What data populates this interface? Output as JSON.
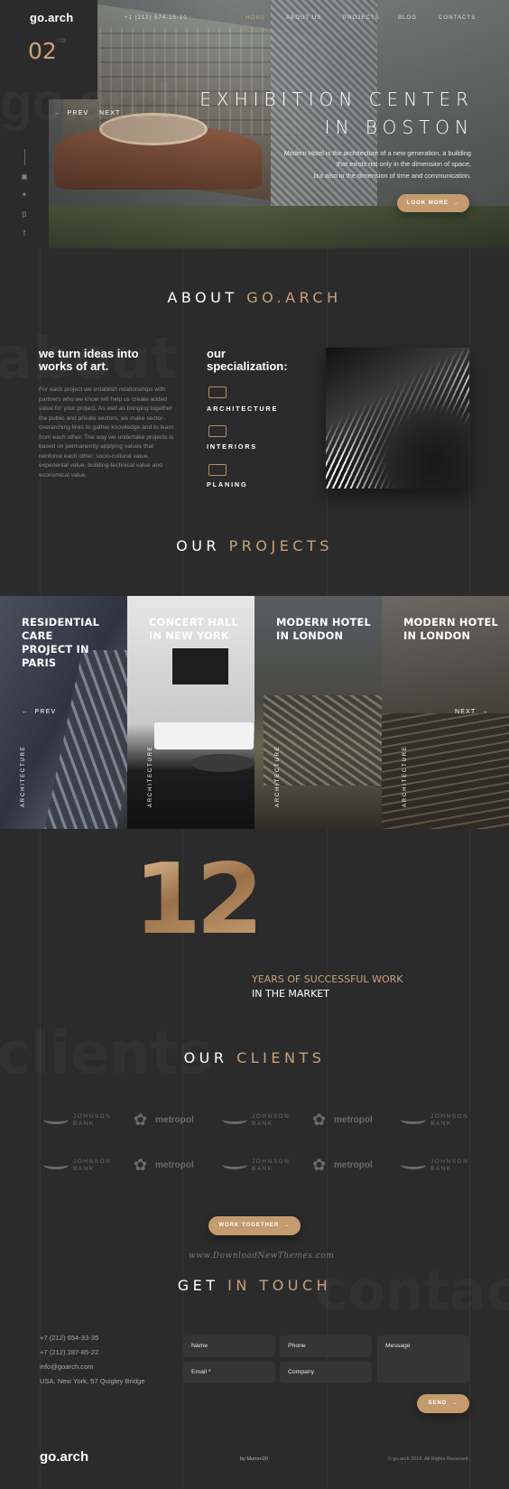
{
  "header": {
    "logo": "go.arch",
    "phone": "+1 (212) 674-25-10",
    "nav": [
      "HOME",
      "ABOUT US",
      "PROJECTS",
      "BLOG",
      "CONTACTS"
    ],
    "active_nav_color": "#c9a27a"
  },
  "hero": {
    "slide_current": "02",
    "slide_total": "/ 03",
    "ghost_text": "go.arch",
    "prev": "PREV",
    "next": "NEXT",
    "title_line1": "EXHIBITION CENTER",
    "title_line2": "IN BOSTON",
    "text_line1": "Modern Hotel is the architecture of a new generation, a building",
    "text_line2": "that exists not only in the dimension of space,",
    "text_line3": "but also in the dimension of time and communication.",
    "button": "LOOK MORE",
    "social_icons": [
      "instagram-icon",
      "twitter-icon",
      "behance-icon",
      "facebook-icon"
    ]
  },
  "about": {
    "title_a": "ABOUT",
    "title_b": "GO.ARCH",
    "ghost": "about",
    "head1": "we turn ideas into",
    "head2": "works of art.",
    "text": "For each project we establish relationships with partners who we know will help us create added value for your project. As well as bringing together the public and private sectors, we make sector-overarching links to gather knowledge and to learn from each other. The way we undertake projects is based on permanently applying values that reinforce each other: socio-cultural value, experiental value, building-technical value and economical value.",
    "spec1": "our",
    "spec2": "specialization:",
    "specs": [
      "ARCHITECTURE",
      "INTERIORS",
      "PLANING"
    ]
  },
  "projects": {
    "title_a": "OUR",
    "title_b": "PROJECTS",
    "prev": "PREV",
    "next": "NEXT",
    "items": [
      {
        "l1": "RESIDENTIAL CARE",
        "l2": "PROJECT IN PARIS",
        "cat": "ARCHITECTURE"
      },
      {
        "l1": "CONCERT HALL",
        "l2": "IN NEW YORK",
        "cat": "ARCHITECTURE"
      },
      {
        "l1": "MODERN HOTEL",
        "l2": "IN LONDON",
        "cat": "ARCHITECTURE"
      },
      {
        "l1": "MODERN HOTEL",
        "l2": "IN LONDON",
        "cat": "ARCHITECTURE"
      }
    ]
  },
  "stats": {
    "number": "12",
    "line1": "YEARS OF SUCCESSFUL WORK",
    "line2": "IN THE MARKET"
  },
  "clients": {
    "title_a": "OUR",
    "title_b": "CLIENTS",
    "ghost": "clients",
    "johnson_1": "JOHNSON",
    "johnson_2": "BANK",
    "metropol": "metropol",
    "button": "WORK TOGETHER",
    "watermark": "www.DownloadNewThemes.com"
  },
  "contact": {
    "title_a": "GET",
    "title_b": "IN TOUCH",
    "ghost": "contact",
    "phone1": "+7 (212) 654-33-35",
    "phone2": "+7 (212) 287-85-22",
    "email": "info@goarch.com",
    "address": "USA, New York, 57 Quigley Bridge",
    "fields": {
      "name": "Name",
      "phone": "Phone",
      "message": "Message",
      "email": "Email *",
      "company": "Company"
    },
    "button": "SEND"
  },
  "footer": {
    "logo": "go.arch",
    "by": "by Murren20",
    "copyright": "© go.arch 2016. All Rights Reserved."
  }
}
